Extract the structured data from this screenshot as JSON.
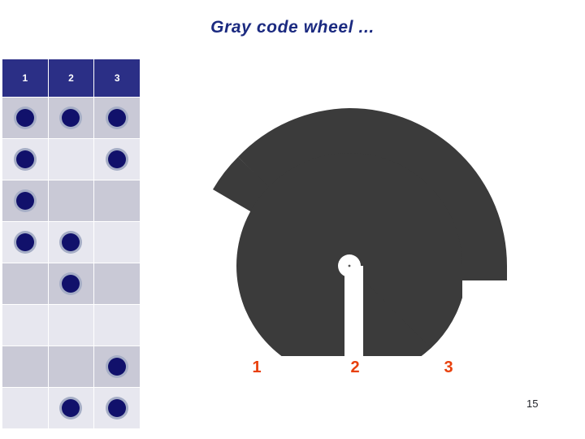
{
  "slide": {
    "title": "Gray code wheel ...",
    "page_number": "15"
  },
  "table": {
    "headers": [
      "1",
      "2",
      "3"
    ],
    "rows": [
      {
        "bits": [
          1,
          1,
          1
        ]
      },
      {
        "bits": [
          1,
          0,
          1
        ]
      },
      {
        "bits": [
          1,
          0,
          0
        ]
      },
      {
        "bits": [
          1,
          1,
          0
        ]
      },
      {
        "bits": [
          0,
          1,
          0
        ]
      },
      {
        "bits": [
          0,
          0,
          0
        ]
      },
      {
        "bits": [
          0,
          0,
          1
        ]
      },
      {
        "bits": [
          0,
          1,
          1
        ]
      }
    ]
  },
  "wheel": {
    "track_labels": [
      "1",
      "2",
      "3"
    ],
    "disc_color": "#3b3b3b",
    "gap_color": "#ffffff",
    "hub_color": "#ffffff",
    "label_color": "#e8400c"
  },
  "colors": {
    "title": "#1b2a80",
    "header_bg": "#2b2f86",
    "header_text": "#ffffff",
    "row_dark": "#c9c9d6",
    "row_light": "#e7e7ef",
    "dot": "#11116b",
    "dot_ring": "#a6aec6",
    "page_number": "#22242a"
  }
}
